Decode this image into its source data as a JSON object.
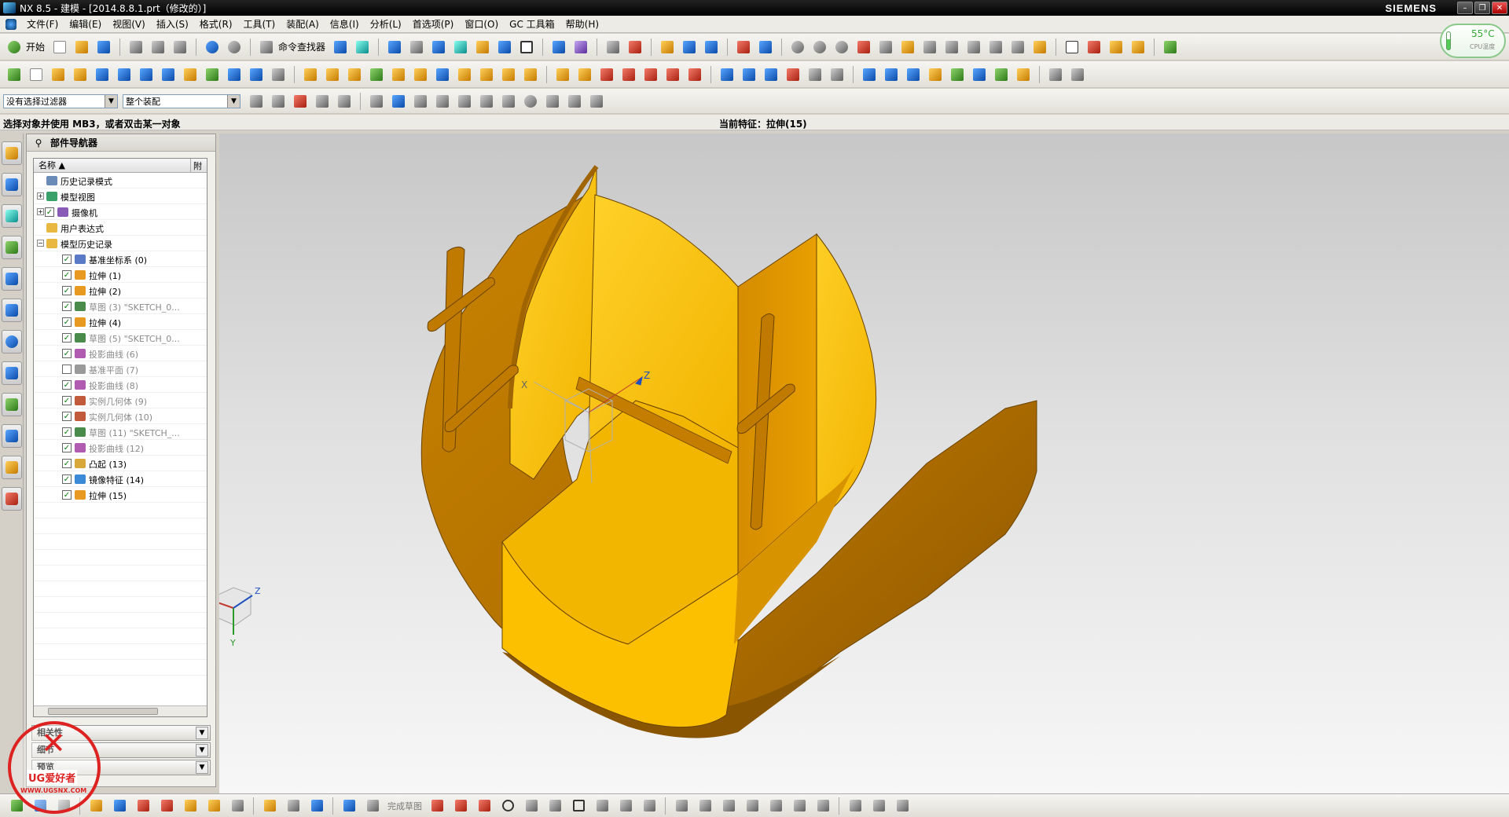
{
  "window": {
    "title": "NX 8.5 - 建模 - [2014.8.8.1.prt（修改的）]",
    "brand": "SIEMENS",
    "min": "–",
    "restore": "❐",
    "close": "✕"
  },
  "menu": [
    "文件(F)",
    "编辑(E)",
    "视图(V)",
    "插入(S)",
    "格式(R)",
    "工具(T)",
    "装配(A)",
    "信息(I)",
    "分析(L)",
    "首选项(P)",
    "窗口(O)",
    "GC 工具箱",
    "帮助(H)"
  ],
  "toolbar": {
    "start_label": "开始",
    "command_finder_label": "命令查找器"
  },
  "selection": {
    "filter_value": "没有选择过滤器",
    "scope_value": "整个装配"
  },
  "status": {
    "prompt": "选择对象并使用 MB3，或者双击某一对象",
    "current_feature": "当前特征：拉伸(15)"
  },
  "navigator": {
    "title": "部件导航器",
    "col_name": "名称",
    "col_attach": "附",
    "items": [
      {
        "label": "历史记录模式",
        "level": 0,
        "expander": "",
        "check": false,
        "grey": false,
        "icon": "clock-icon",
        "color": "#6a8ab8"
      },
      {
        "label": "模型视图",
        "level": 0,
        "expander": "+",
        "check": false,
        "grey": false,
        "icon": "model-views-icon",
        "color": "#3aa06a"
      },
      {
        "label": "摄像机",
        "level": 0,
        "expander": "+",
        "check": true,
        "grey": false,
        "icon": "camera-icon",
        "color": "#8a5ab8"
      },
      {
        "label": "用户表达式",
        "level": 0,
        "expander": "",
        "check": false,
        "grey": false,
        "icon": "folder-icon",
        "color": "#e8b840"
      },
      {
        "label": "模型历史记录",
        "level": 0,
        "expander": "−",
        "check": false,
        "grey": false,
        "icon": "folder-icon",
        "color": "#e8b840"
      },
      {
        "label": "基准坐标系 (0)",
        "level": 1,
        "expander": "",
        "check": true,
        "grey": false,
        "icon": "datum-csys-icon",
        "color": "#5a7ac8"
      },
      {
        "label": "拉伸 (1)",
        "level": 1,
        "expander": "",
        "check": true,
        "grey": false,
        "icon": "extrude-icon",
        "color": "#e89a20"
      },
      {
        "label": "拉伸 (2)",
        "level": 1,
        "expander": "",
        "check": true,
        "grey": false,
        "icon": "extrude-icon",
        "color": "#e89a20"
      },
      {
        "label": "草图 (3) \"SKETCH_0...",
        "level": 1,
        "expander": "",
        "check": true,
        "grey": true,
        "icon": "sketch-icon",
        "color": "#4a8a4a"
      },
      {
        "label": "拉伸 (4)",
        "level": 1,
        "expander": "",
        "check": true,
        "grey": false,
        "icon": "extrude-icon",
        "color": "#e89a20"
      },
      {
        "label": "草图 (5) \"SKETCH_0...",
        "level": 1,
        "expander": "",
        "check": true,
        "grey": true,
        "icon": "sketch-icon",
        "color": "#4a8a4a"
      },
      {
        "label": "投影曲线 (6)",
        "level": 1,
        "expander": "",
        "check": true,
        "grey": true,
        "icon": "projected-curve-icon",
        "color": "#b05ab0"
      },
      {
        "label": "基准平面 (7)",
        "level": 1,
        "expander": "",
        "check": false,
        "grey": true,
        "icon": "datum-plane-icon",
        "color": "#9a9a9a"
      },
      {
        "label": "投影曲线 (8)",
        "level": 1,
        "expander": "",
        "check": true,
        "grey": true,
        "icon": "projected-curve-icon",
        "color": "#b05ab0"
      },
      {
        "label": "实例几何体 (9)",
        "level": 1,
        "expander": "",
        "check": true,
        "grey": true,
        "icon": "instance-geometry-icon",
        "color": "#c05a3a"
      },
      {
        "label": "实例几何体 (10)",
        "level": 1,
        "expander": "",
        "check": true,
        "grey": true,
        "icon": "instance-geometry-icon",
        "color": "#c05a3a"
      },
      {
        "label": "草图 (11) \"SKETCH_...",
        "level": 1,
        "expander": "",
        "check": true,
        "grey": true,
        "icon": "sketch-icon",
        "color": "#4a8a4a"
      },
      {
        "label": "投影曲线 (12)",
        "level": 1,
        "expander": "",
        "check": true,
        "grey": true,
        "icon": "projected-curve-icon",
        "color": "#b05ab0"
      },
      {
        "label": "凸起 (13)",
        "level": 1,
        "expander": "",
        "check": true,
        "grey": false,
        "icon": "emboss-icon",
        "color": "#d8a83a"
      },
      {
        "label": "镜像特征 (14)",
        "level": 1,
        "expander": "",
        "check": true,
        "grey": false,
        "icon": "mirror-feature-icon",
        "color": "#3a8ad8"
      },
      {
        "label": "拉伸 (15)",
        "level": 1,
        "expander": "",
        "check": true,
        "grey": false,
        "icon": "extrude-icon",
        "color": "#e89a20"
      }
    ],
    "panels": [
      "相关性",
      "细节",
      "预览"
    ]
  },
  "sketch": {
    "finish_label": "完成草图"
  },
  "viewport": {
    "axis_x": "X",
    "axis_y": "Y",
    "axis_z": "Z",
    "part_color": "#f5b800"
  },
  "gauge": {
    "temp": "55°C",
    "label": "CPU温度"
  },
  "watermark": {
    "brand": "UG爱好者",
    "url": "WWW.UGSNX.COM"
  }
}
